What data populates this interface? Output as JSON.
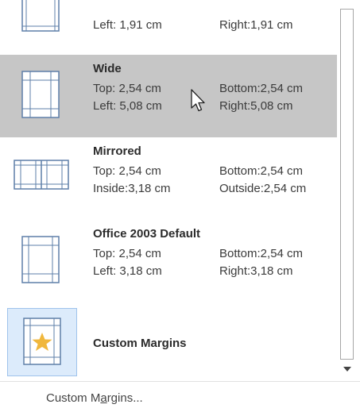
{
  "margins_menu": {
    "presets": [
      {
        "name": "",
        "line1": {
          "left": "",
          "right": ""
        },
        "line2": {
          "left": "Left:  1,91 cm",
          "right": "Right:1,91 cm"
        },
        "selected": false,
        "thumb_icon": "margins-narrow-icon"
      },
      {
        "name": "Wide",
        "line1": {
          "left": "Top:  2,54 cm",
          "right": "Bottom:2,54 cm"
        },
        "line2": {
          "left": "Left:  5,08 cm",
          "right": "Right:5,08 cm"
        },
        "selected": true,
        "thumb_icon": "margins-wide-icon"
      },
      {
        "name": "Mirrored",
        "line1": {
          "left": "Top:  2,54 cm",
          "right": "Bottom:2,54 cm"
        },
        "line2": {
          "left": "Inside:3,18 cm",
          "right": "Outside:2,54 cm"
        },
        "selected": false,
        "thumb_icon": "margins-mirrored-icon"
      },
      {
        "name": "Office 2003 Default",
        "line1": {
          "left": "Top:  2,54 cm",
          "right": "Bottom:2,54 cm"
        },
        "line2": {
          "left": "Left:  3,18 cm",
          "right": "Right:3,18 cm"
        },
        "selected": false,
        "thumb_icon": "margins-office2003-icon"
      }
    ],
    "custom_item": {
      "name": "Custom Margins",
      "thumb_icon": "custom-margins-star-icon"
    },
    "footer": {
      "label_before": "Custom M",
      "label_accel": "a",
      "label_after": "rgins..."
    },
    "colors": {
      "selected_bg": "#c6c6c6",
      "custom_thumb_bg": "#dcebfb",
      "thumb_line": "#5e7fa8",
      "star": "#f0b73c"
    },
    "icons": {
      "scroll_down": "triangle-down-icon",
      "cursor": "mouse-pointer-icon"
    }
  }
}
